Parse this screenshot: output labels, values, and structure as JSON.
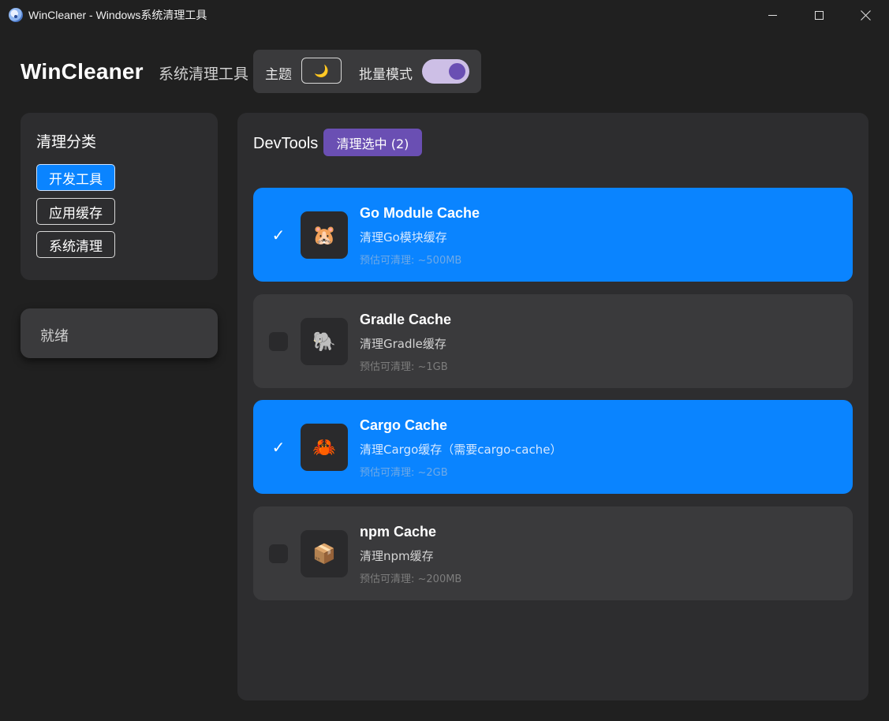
{
  "window": {
    "title": "WinCleaner - Windows系统清理工具",
    "controls": [
      "minimize",
      "maximize",
      "close"
    ]
  },
  "header": {
    "brand": "WinCleaner",
    "subtitle": "系统清理工具",
    "theme_label": "主题",
    "theme_icon": "moon-icon",
    "theme_glyph": "🌙",
    "batch_label": "批量模式",
    "batch_mode_on": true
  },
  "sidebar": {
    "title": "清理分类",
    "categories": [
      {
        "label": "开发工具",
        "active": true
      },
      {
        "label": "应用缓存",
        "active": false
      },
      {
        "label": "系统清理",
        "active": false
      }
    ],
    "status": "就绪"
  },
  "main": {
    "title": "DevTools",
    "clean_button": "清理选中 (2)",
    "items": [
      {
        "name": "Go Module Cache",
        "desc": "清理Go模块缓存",
        "estimate": "预估可清理: ~500MB",
        "icon": "🐹",
        "icon_name": "gopher-icon",
        "selected": true,
        "check": "✓"
      },
      {
        "name": "Gradle Cache",
        "desc": "清理Gradle缓存",
        "estimate": "预估可清理: ~1GB",
        "icon": "🐘",
        "icon_name": "elephant-icon",
        "selected": false,
        "check": ""
      },
      {
        "name": "Cargo Cache",
        "desc": "清理Cargo缓存（需要cargo-cache）",
        "estimate": "预估可清理: ~2GB",
        "icon": "🦀",
        "icon_name": "crab-icon",
        "selected": true,
        "check": "✓"
      },
      {
        "name": "npm Cache",
        "desc": "清理npm缓存",
        "estimate": "预估可清理: ~200MB",
        "icon": "📦",
        "icon_name": "package-icon",
        "selected": false,
        "check": ""
      }
    ]
  },
  "colors": {
    "accent": "#0a84ff",
    "purple": "#6a4fb3",
    "background": "#202020",
    "panel": "#2d2d2f"
  }
}
